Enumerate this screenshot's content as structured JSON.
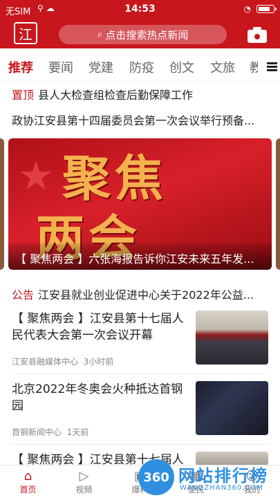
{
  "status_bar": {
    "carrier": "无SIM",
    "time": "14:53",
    "battery_level": 0.85
  },
  "header": {
    "logo_text": "江",
    "search_placeholder": "点击搜索热点新闻"
  },
  "tabs": [
    "推荐",
    "要闻",
    "党建",
    "防疫",
    "创文",
    "文旅",
    "教"
  ],
  "active_tab": 0,
  "pinned": {
    "tag": "置顶",
    "title": "县人大检查组检查后勤保障工作"
  },
  "headline": "政协江安县第十四届委员会第一次会议举行预备...",
  "banner": {
    "big_text_1": "聚焦",
    "big_text_2": "两会",
    "caption": "【 聚焦两会 】六张海报告诉你江安未来五年发..."
  },
  "notice": {
    "tag": "公告",
    "title": "江安县就业创业促进中心关于2022年公益..."
  },
  "news": [
    {
      "title": "【 聚焦两会 】江安县第十七届人民代表大会第一次会议开幕",
      "source": "江安县融媒体中心",
      "time": "3小时前"
    },
    {
      "title": "北京2022年冬奥会火种抵达首钢园",
      "source": "首钢新闻中心",
      "time": "1天前"
    },
    {
      "title": "【 聚焦两会 】江安县第十七届人民",
      "source": "",
      "time": ""
    }
  ],
  "bottom_nav": [
    {
      "label": "首页",
      "icon": "home-icon"
    },
    {
      "label": "视频",
      "icon": "play-icon"
    },
    {
      "label": "爆料",
      "icon": "camera-icon"
    },
    {
      "label": "便民",
      "icon": "grid-icon"
    },
    {
      "label": "我的",
      "icon": "user-icon"
    }
  ],
  "watermark": {
    "badge": "360",
    "title": "网站排行榜",
    "subtitle": "WANGZHAN360.COM"
  },
  "colors": {
    "brand_red": "#c8161d",
    "banner_gold": "#f4b24e",
    "watermark_blue": "#2f8fe0"
  }
}
